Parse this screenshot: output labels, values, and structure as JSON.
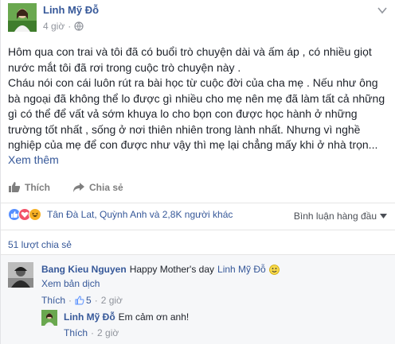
{
  "post": {
    "author": "Linh Mỹ Đỗ",
    "time": "4 giờ",
    "paragraphs": [
      "Hôm qua con trai và tôi đã có buổi trò chuyện dài và ấm áp , có nhiều giọt nước mắt tôi đã rơi trong cuộc trò chuyện này .",
      "Cháu nói con cái luôn rút ra bài học từ cuộc đời của cha mẹ . Nếu như ông bà ngoại đã không thể lo được gì nhiều cho mẹ nên mẹ đã làm tất cả những gì có thể để vất vả sớm khuya lo cho bọn con được học hành ở những trường tốt nhất , sống ở nơi thiên nhiên trong lành nhất. Nhưng vì nghề nghiệp của mẹ để con được như vậy thì mẹ lại chẳng mấy khi ở nhà trọn..."
    ],
    "see_more": "Xem thêm"
  },
  "actions": {
    "like": "Thích",
    "share": "Chia sẻ"
  },
  "reactions": {
    "summary": "Tân Đà Lat, Quỳnh Anh và 2,8K người khác",
    "sort_label": "Bình luận hàng đầu",
    "types": [
      "like",
      "love",
      "haha"
    ]
  },
  "shares": "51 lượt chia sẻ",
  "comments": [
    {
      "author": "Bang Kieu Nguyen",
      "text": "Happy Mother's day",
      "mention": "Linh Mỹ Đỗ",
      "translate": "Xem bản dịch",
      "like": "Thích",
      "like_count": "5",
      "time": "2 giờ",
      "reply": {
        "author": "Linh Mỹ Đỗ",
        "text": "Em cảm ơn anh!",
        "like": "Thích",
        "time": "2 giờ"
      }
    }
  ],
  "colors": {
    "link": "#365899",
    "muted": "#90949c",
    "like_blue": "#5890ff",
    "love_red": "#f25268",
    "haha_yellow": "#f7b125"
  }
}
